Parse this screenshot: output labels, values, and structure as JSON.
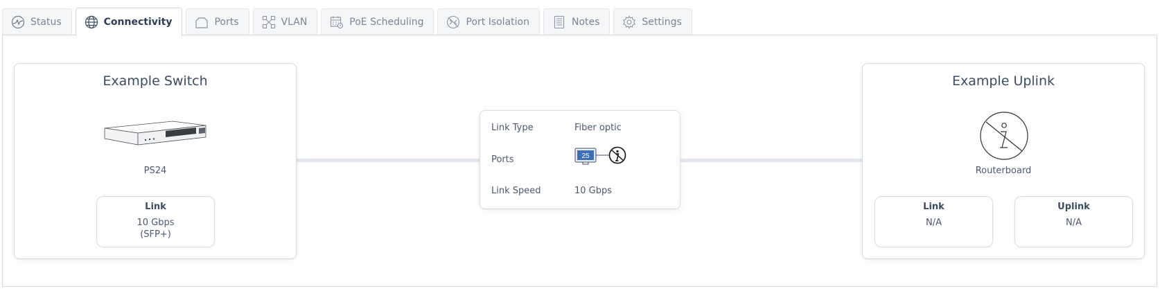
{
  "tabs": [
    {
      "label": "Status",
      "icon": "activity-icon",
      "active": false
    },
    {
      "label": "Connectivity",
      "icon": "globe-icon",
      "active": true
    },
    {
      "label": "Ports",
      "icon": "ports-icon",
      "active": false
    },
    {
      "label": "VLAN",
      "icon": "vlan-icon",
      "active": false
    },
    {
      "label": "PoE Scheduling",
      "icon": "calendar-icon",
      "active": false
    },
    {
      "label": "Port Isolation",
      "icon": "isolation-icon",
      "active": false
    },
    {
      "label": "Notes",
      "icon": "notes-icon",
      "active": false
    },
    {
      "label": "Settings",
      "icon": "gear-icon",
      "active": false
    }
  ],
  "switch": {
    "title": "Example Switch",
    "model": "PS24",
    "link": {
      "label": "Link",
      "value": "10 Gbps",
      "detail": "(SFP+)"
    }
  },
  "link": {
    "type_label": "Link Type",
    "type_value": "Fiber optic",
    "ports_label": "Ports",
    "port_number": "25",
    "speed_label": "Link Speed",
    "speed_value": "10 Gbps"
  },
  "uplink": {
    "title": "Example Uplink",
    "device": "Routerboard",
    "link": {
      "label": "Link",
      "value": "N/A"
    },
    "uplink": {
      "label": "Uplink",
      "value": "N/A"
    }
  },
  "colors": {
    "accent": "#2d3e5a",
    "connector": "#e2e7ef",
    "port": "#3d6fb6"
  }
}
